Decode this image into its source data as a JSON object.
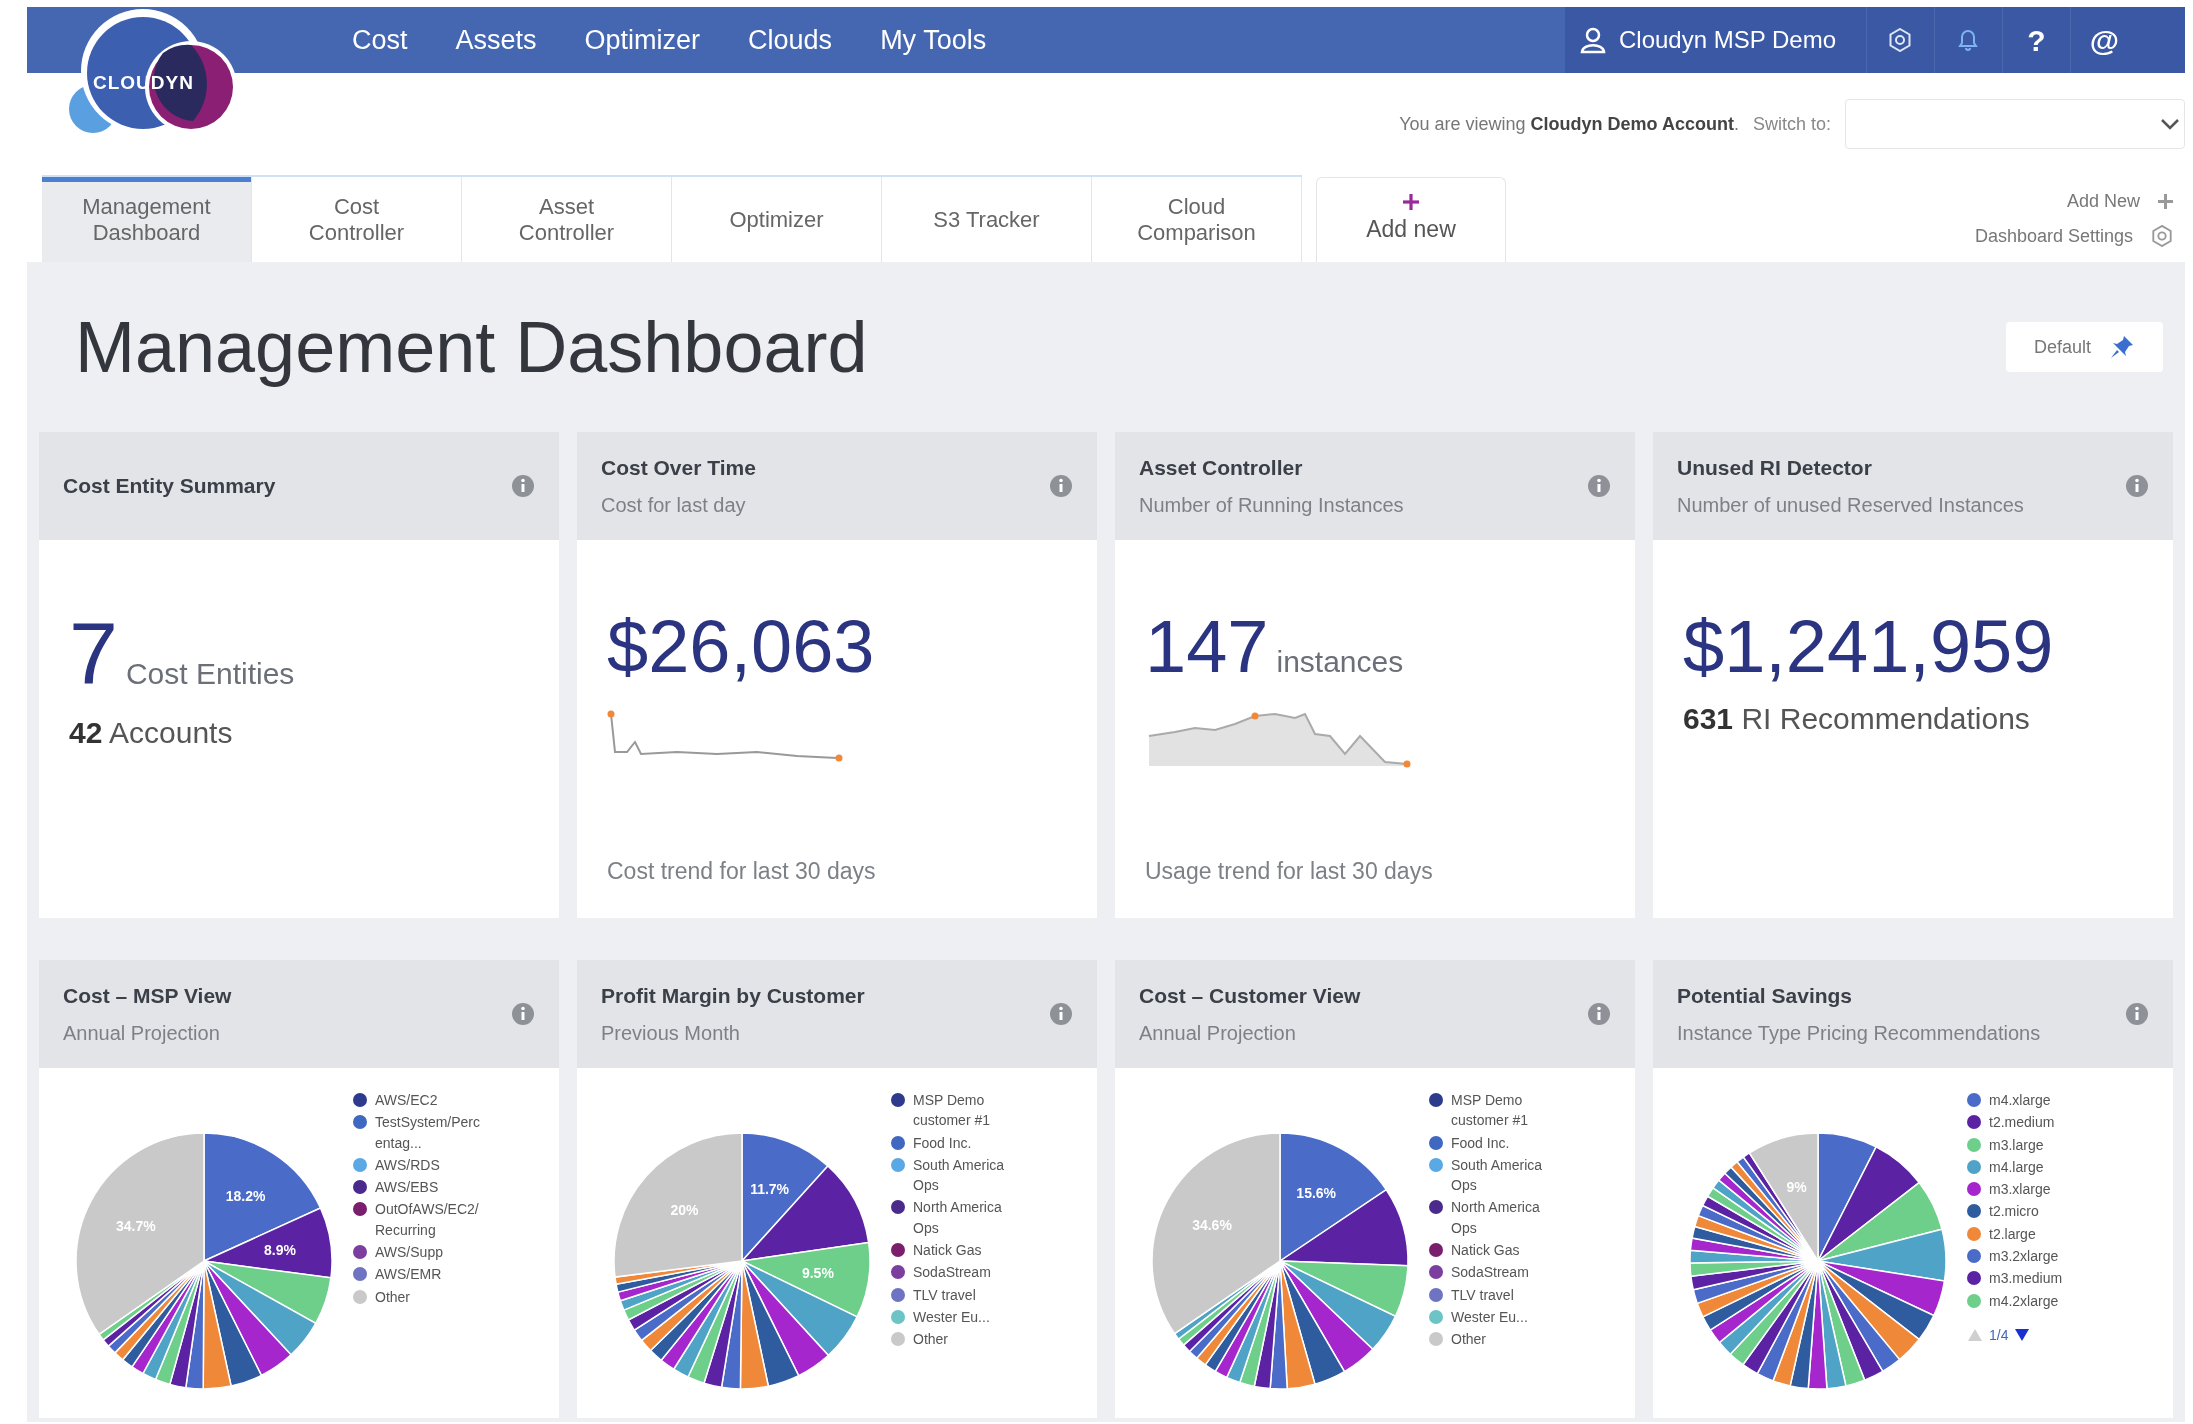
{
  "logo": "CLOUDYN",
  "top_menu": [
    {
      "label": "Cost"
    },
    {
      "label": "Assets"
    },
    {
      "label": "Optimizer"
    },
    {
      "label": "Clouds"
    },
    {
      "label": "My Tools"
    }
  ],
  "user": "Cloudyn MSP Demo",
  "nav_actions": [
    {
      "kind": "settings"
    },
    {
      "kind": "notifications"
    },
    {
      "kind": "text",
      "text": "?"
    },
    {
      "kind": "text",
      "text": "@"
    }
  ],
  "account_bar": {
    "text": "You are viewing **Cloudyn Demo Account**.",
    "switch_label": "Switch to:"
  },
  "tabs": [
    {
      "label": "Management Dashboard",
      "selected": true
    },
    {
      "label": "Cost Controller",
      "selected": false
    },
    {
      "label": "Asset Controller",
      "selected": false
    },
    {
      "label": "Optimizer",
      "selected": false
    },
    {
      "label": "S3 Tracker",
      "selected": false
    },
    {
      "label": "Cloud Comparison",
      "selected": false
    }
  ],
  "add_tab": {
    "label": "Add new"
  },
  "side_links": [
    {
      "kind": "add",
      "label": "Add New"
    },
    {
      "kind": "settings",
      "label": "Dashboard Settings"
    }
  ],
  "page_title": "Management Dashboard",
  "default_button": "Default",
  "widgets": [
    {
      "kind": "count",
      "title": "Cost Entity Summary",
      "value": "7",
      "unit": "Cost Entities",
      "detail_value": "42",
      "detail_label": "Accounts"
    },
    {
      "kind": "trend",
      "title": "Cost Over Time",
      "subtitle": "Cost for last day",
      "value": "$26,063",
      "caption": "Cost trend for last 30 days"
    },
    {
      "kind": "trend",
      "title": "Asset Controller",
      "subtitle": "Number of Running Instances",
      "value": "147",
      "unit": "instances",
      "caption": "Usage trend for last 30 days"
    },
    {
      "kind": "count",
      "title": "Unused RI Detector",
      "subtitle": "Number of unused Reserved Instances",
      "value": "$1,241,959",
      "detail_value": "631",
      "detail_label": "RI Recommendations"
    },
    {
      "kind": "pie",
      "title": "Cost – MSP View",
      "subtitle": "Annual Projection",
      "slice_labels": [
        "18.2%",
        "8.9%",
        "34.7%"
      ],
      "legend": [
        {
          "label": "AWS/EC2",
          "color": "#2e3a8c"
        },
        {
          "label": "TestSystem/Percentag...",
          "color": "#3f68c0"
        },
        {
          "label": "AWS/RDS",
          "color": "#5aa8e4"
        },
        {
          "label": "AWS/EBS",
          "color": "#4a2b8c"
        },
        {
          "label": "OutOfAWS/EC2/Recurring",
          "color": "#7a1e6e"
        },
        {
          "label": "AWS/Supp",
          "color": "#7c3fa0"
        },
        {
          "label": "AWS/EMR",
          "color": "#6e74c2"
        },
        {
          "label": "Other",
          "color": "#c9c9c9"
        }
      ]
    },
    {
      "kind": "pie",
      "title": "Profit Margin by Customer",
      "subtitle": "Previous Month",
      "slice_labels": [
        "11.7%",
        "9.5%",
        "20%"
      ],
      "legend": [
        {
          "label": "MSP Demo customer #1",
          "color": "#2e3a8c"
        },
        {
          "label": "Food Inc.",
          "color": "#3f68c0"
        },
        {
          "label": "South America Ops",
          "color": "#5aa8e4"
        },
        {
          "label": "North America Ops",
          "color": "#4a2b8c"
        },
        {
          "label": "Natick Gas",
          "color": "#7a1e6e"
        },
        {
          "label": "SodaStream",
          "color": "#7c3fa0"
        },
        {
          "label": "TLV travel",
          "color": "#6e74c2"
        },
        {
          "label": "Wester Eu...",
          "color": "#6cc4c4"
        },
        {
          "label": "Other",
          "color": "#c9c9c9"
        }
      ]
    },
    {
      "kind": "pie",
      "title": "Cost – Customer View",
      "subtitle": "Annual Projection",
      "slice_labels": [
        "15.6%",
        "34.6%"
      ],
      "legend": [
        {
          "label": "MSP Demo customer #1",
          "color": "#2e3a8c"
        },
        {
          "label": "Food Inc.",
          "color": "#3f68c0"
        },
        {
          "label": "South America Ops",
          "color": "#5aa8e4"
        },
        {
          "label": "North America Ops",
          "color": "#4a2b8c"
        },
        {
          "label": "Natick Gas",
          "color": "#7a1e6e"
        },
        {
          "label": "SodaStream",
          "color": "#7c3fa0"
        },
        {
          "label": "TLV travel",
          "color": "#6e74c2"
        },
        {
          "label": "Wester Eu...",
          "color": "#6cc4c4"
        },
        {
          "label": "Other",
          "color": "#c9c9c9"
        }
      ]
    },
    {
      "kind": "pie",
      "title": "Potential Savings",
      "subtitle": "Instance Type Pricing Recommendations",
      "slice_labels": [
        "9%"
      ],
      "legend": [
        {
          "label": "m4.xlarge",
          "color": "#4a6cc8"
        },
        {
          "label": "t2.medium",
          "color": "#5b23a3"
        },
        {
          "label": "m3.large",
          "color": "#6dcf8a"
        },
        {
          "label": "m4.large",
          "color": "#4fa3c6"
        },
        {
          "label": "m3.xlarge",
          "color": "#a426cc"
        },
        {
          "label": "t2.micro",
          "color": "#2e5c9e"
        },
        {
          "label": "t2.large",
          "color": "#f0883a"
        },
        {
          "label": "m3.2xlarge",
          "color": "#4a6cc8"
        },
        {
          "label": "m3.medium",
          "color": "#5b23a3"
        },
        {
          "label": "m4.2xlarge",
          "color": "#6dcf8a"
        }
      ],
      "pager": {
        "text": "1/4",
        "prev_disabled": true,
        "next_disabled": false
      }
    }
  ]
}
